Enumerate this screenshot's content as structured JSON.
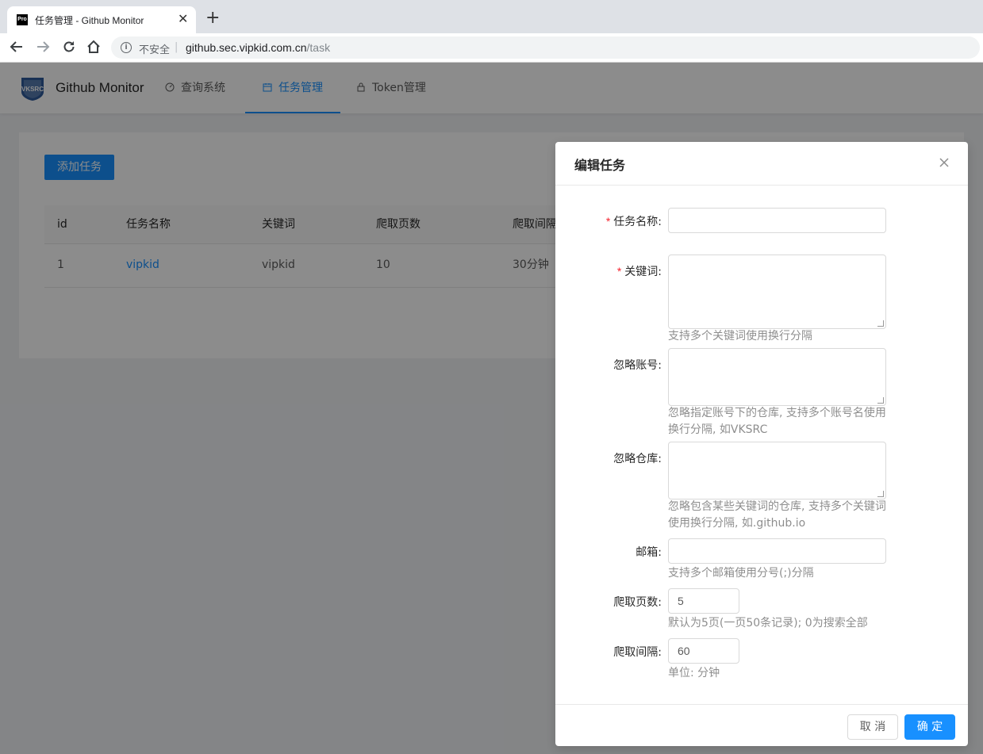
{
  "browser": {
    "tab_title": "任务管理 - Github Monitor",
    "tab_favicon": "Pro",
    "tab_close": "✕",
    "new_tab": "+",
    "insecure_label": "不安全",
    "url_host": "github.sec.vipkid.com.cn",
    "url_path": "/task"
  },
  "header": {
    "logo_text": "VKSRC",
    "app_name": "Github Monitor",
    "menu": [
      {
        "label": "查询系统",
        "icon": "dashboard-icon"
      },
      {
        "label": "任务管理",
        "icon": "calendar-icon",
        "active": true
      },
      {
        "label": "Token管理",
        "icon": "lock-icon"
      }
    ]
  },
  "main": {
    "add_button": "添加任务",
    "columns": [
      "id",
      "任务名称",
      "关键词",
      "爬取页数",
      "爬取间隔"
    ],
    "rows": [
      {
        "id": "1",
        "name": "vipkid",
        "keyword": "vipkid",
        "pages": "10",
        "interval": "30分钟"
      }
    ]
  },
  "modal": {
    "title": "编辑任务",
    "fields": {
      "name": {
        "label": "任务名称",
        "value": ""
      },
      "keywords": {
        "label": "关键词",
        "help": "支持多个关键词使用换行分隔"
      },
      "ignore_accounts": {
        "label": "忽略账号",
        "help1": "忽略指定账号下的仓库, 支持多个账号名使用",
        "help2": "换行分隔, 如VKSRC"
      },
      "ignore_repos": {
        "label": "忽略仓库",
        "help1": "忽略包含某些关键词的仓库, 支持多个关键词",
        "help2": "使用换行分隔, 如.github.io"
      },
      "email": {
        "label": "邮箱",
        "help": "支持多个邮箱使用分号(;)分隔"
      },
      "pages": {
        "label": "爬取页数",
        "value": "5",
        "help": "默认为5页(一页50条记录); 0为搜索全部"
      },
      "interval": {
        "label": "爬取间隔",
        "value": "60",
        "help": "单位: 分钟"
      }
    },
    "colon": ":",
    "required_mark": "*",
    "cancel": "取 消",
    "ok": "确 定"
  },
  "colors": {
    "primary": "#1890ff",
    "mask": "rgba(0,0,0,0.45)"
  }
}
